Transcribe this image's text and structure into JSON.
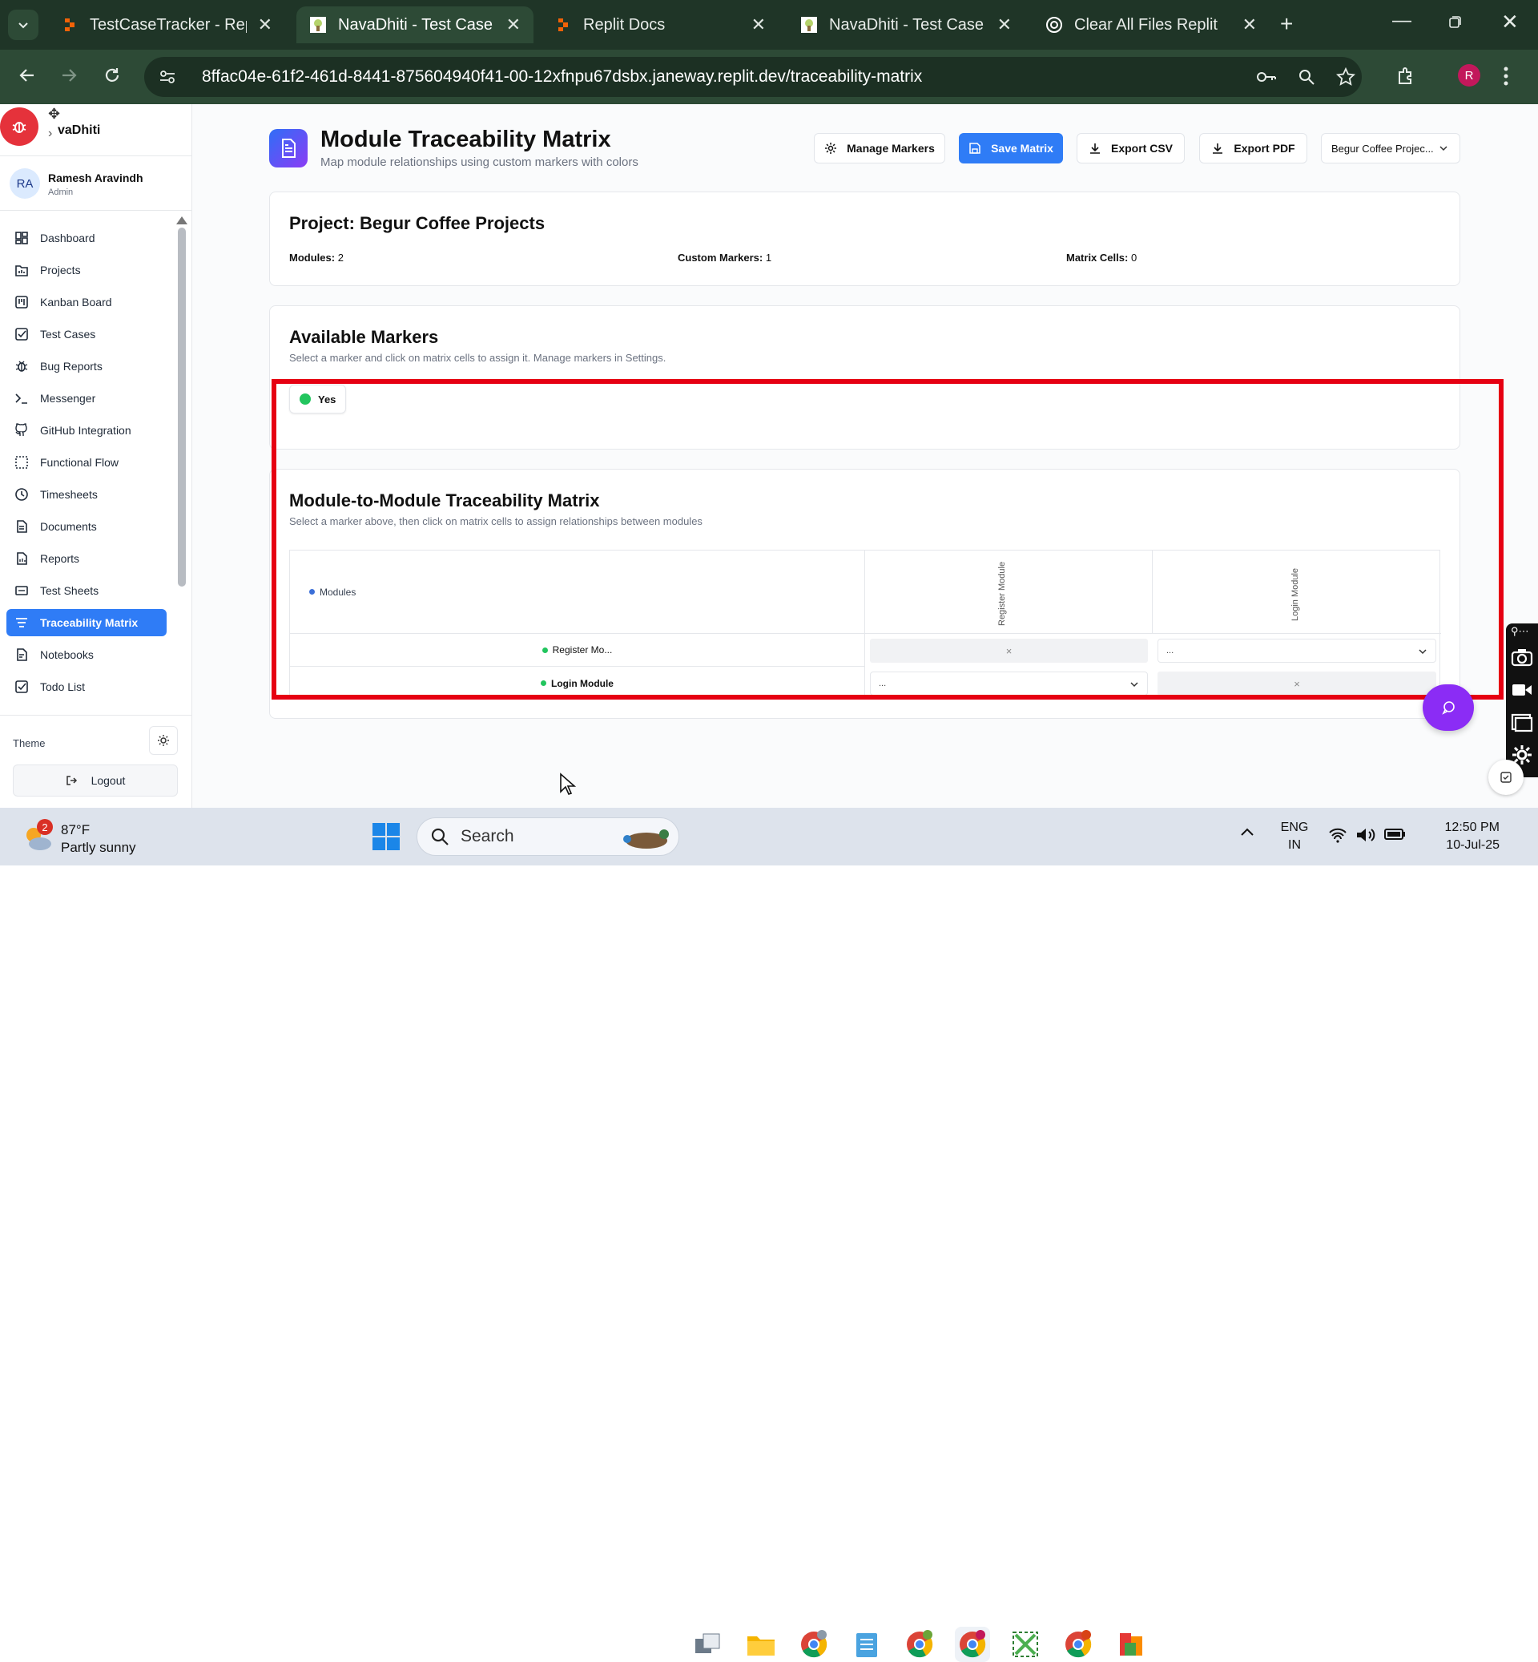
{
  "browser": {
    "tabs": [
      {
        "label": "TestCaseTracker - Replit",
        "active": false
      },
      {
        "label": "NavaDhiti - Test Case Ma",
        "active": true
      },
      {
        "label": "Replit Docs",
        "active": false
      },
      {
        "label": "NavaDhiti - Test Case Ma",
        "active": false
      },
      {
        "label": "Clear All Files Replit",
        "active": false
      }
    ],
    "url": "8ffac04e-61f2-461d-8441-875604940f41-00-12xfnpu67dsbx.janeway.replit.dev/traceability-matrix",
    "profile_initial": "R"
  },
  "sidebar": {
    "brand": "vaDhiti",
    "user": {
      "initials": "RA",
      "name": "Ramesh Aravindh",
      "role": "Admin"
    },
    "items": [
      {
        "label": "Dashboard",
        "icon": "dashboard-icon"
      },
      {
        "label": "Projects",
        "icon": "projects-icon"
      },
      {
        "label": "Kanban Board",
        "icon": "kanban-icon"
      },
      {
        "label": "Test Cases",
        "icon": "checkbox-icon"
      },
      {
        "label": "Bug Reports",
        "icon": "bug-icon"
      },
      {
        "label": "Messenger",
        "icon": "terminal-icon"
      },
      {
        "label": "GitHub Integration",
        "icon": "github-icon"
      },
      {
        "label": "Functional Flow",
        "icon": "flow-icon"
      },
      {
        "label": "Timesheets",
        "icon": "clock-icon"
      },
      {
        "label": "Documents",
        "icon": "document-icon"
      },
      {
        "label": "Reports",
        "icon": "report-icon"
      },
      {
        "label": "Test Sheets",
        "icon": "sheet-icon"
      },
      {
        "label": "Traceability Matrix",
        "icon": "filter-icon",
        "active": true
      },
      {
        "label": "Notebooks",
        "icon": "notebook-icon"
      },
      {
        "label": "Todo List",
        "icon": "todo-icon"
      }
    ],
    "theme_label": "Theme",
    "logout_label": "Logout"
  },
  "header": {
    "title": "Module Traceability Matrix",
    "subtitle": "Map module relationships using custom markers with colors",
    "manage_markers": "Manage Markers",
    "save_matrix": "Save Matrix",
    "export_csv": "Export CSV",
    "export_pdf": "Export PDF",
    "project_select": "Begur Coffee Projec..."
  },
  "project": {
    "title": "Project: Begur Coffee Projects",
    "modules_label": "Modules:",
    "modules_value": "2",
    "markers_label": "Custom Markers:",
    "markers_value": "1",
    "cells_label": "Matrix Cells:",
    "cells_value": "0"
  },
  "markers": {
    "title": "Available Markers",
    "subtitle": "Select a marker and click on matrix cells to assign it. Manage markers in Settings.",
    "items": [
      {
        "label": "Yes",
        "color": "#22c55e"
      }
    ]
  },
  "matrix": {
    "title": "Module-to-Module Traceability Matrix",
    "subtitle": "Select a marker above, then click on matrix cells to assign relationships between modules",
    "corner_label": "Modules",
    "columns": [
      "Register Module",
      "Login Module"
    ],
    "rows": [
      "Register Mo...",
      "Login Module"
    ],
    "self_mark": "×",
    "empty_value": "..."
  },
  "taskbar": {
    "weather_temp": "87°F",
    "weather_desc": "Partly sunny",
    "weather_badge": "2",
    "search_placeholder": "Search",
    "lang_top": "ENG",
    "lang_bottom": "IN",
    "time": "12:50 PM",
    "date": "10-Jul-25"
  },
  "colors": {
    "accent": "#2f7cf6",
    "highlight_box": "#e60012",
    "marker_green": "#22c55e",
    "chat_fab": "#8b2cf5"
  }
}
